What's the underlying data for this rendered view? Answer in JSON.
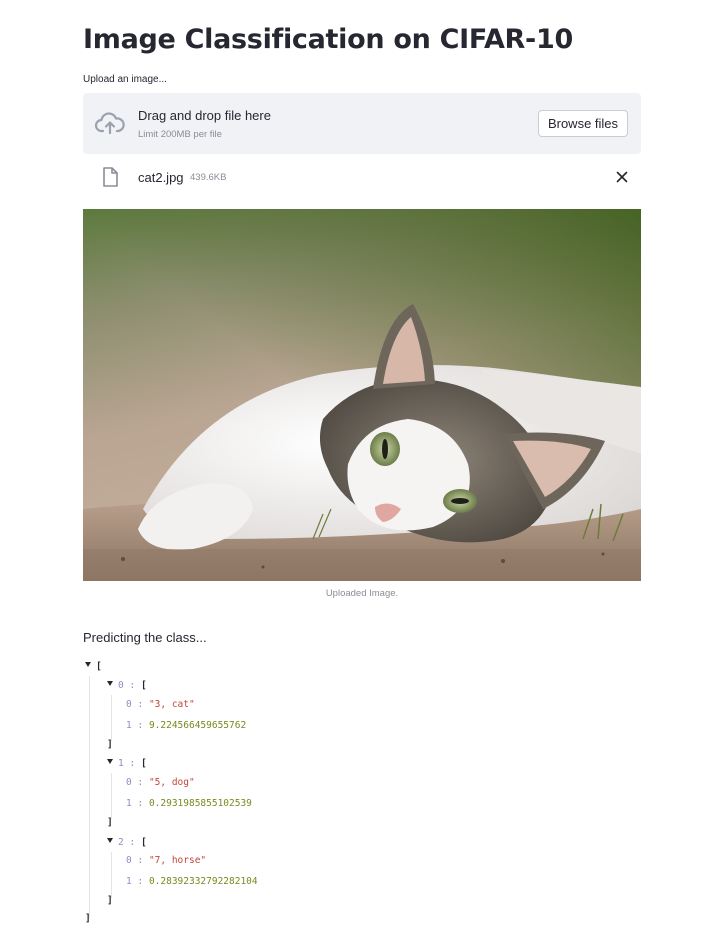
{
  "page": {
    "title": "Image Classification on CIFAR-10"
  },
  "uploader": {
    "label": "Upload an image...",
    "drop_title": "Drag and drop file here",
    "drop_limit": "Limit 200MB per file",
    "browse_label": "Browse files"
  },
  "file": {
    "name": "cat2.jpg",
    "size": "439.6KB"
  },
  "image": {
    "caption": "Uploaded Image."
  },
  "status": {
    "predicting": "Predicting the class..."
  },
  "predictions": [
    {
      "index": "0",
      "label": "\"3, cat\"",
      "score": "9.224566459655762"
    },
    {
      "index": "1",
      "label": "\"5, dog\"",
      "score": "0.2931985855102539"
    },
    {
      "index": "2",
      "label": "\"7, horse\"",
      "score": "0.28392332792282104"
    }
  ],
  "json_syntax": {
    "open_bracket": "[",
    "close_bracket": "]",
    "colon": ":",
    "key0": "0",
    "key1": "1"
  },
  "colors": {
    "accent_bg": "#f0f2f6",
    "text": "#262730",
    "muted": "#8a8d96",
    "json_key": "#8a8fc4",
    "json_string": "#c0473a",
    "json_number": "#7a8a1e"
  },
  "icons": {
    "upload": "cloud-upload-icon",
    "file": "file-icon",
    "close": "close-icon",
    "collapse": "caret-down-icon"
  }
}
